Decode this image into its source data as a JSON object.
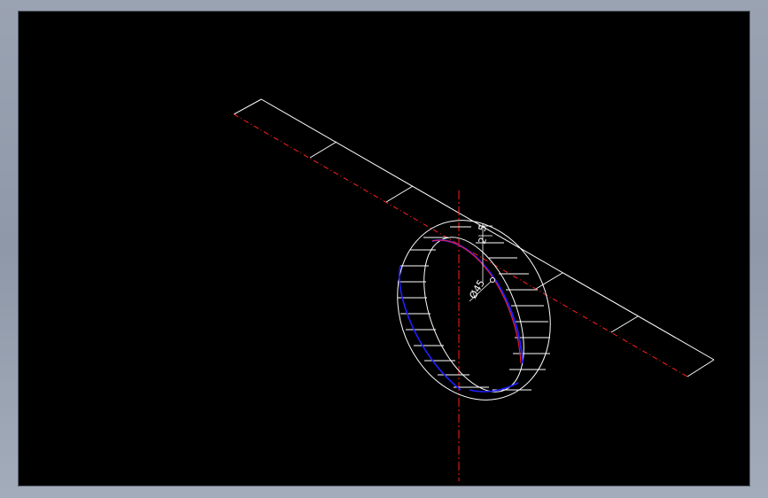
{
  "drawing": {
    "dimension_diameter": "Ø45",
    "dimension_side_a": "5",
    "dimension_side_b": "2"
  },
  "colors": {
    "background": "#000000",
    "frame": "#9aa3b2",
    "geometry": "#ffffff",
    "centerline": "#ff2020",
    "inner_edge": "#2020ff"
  }
}
